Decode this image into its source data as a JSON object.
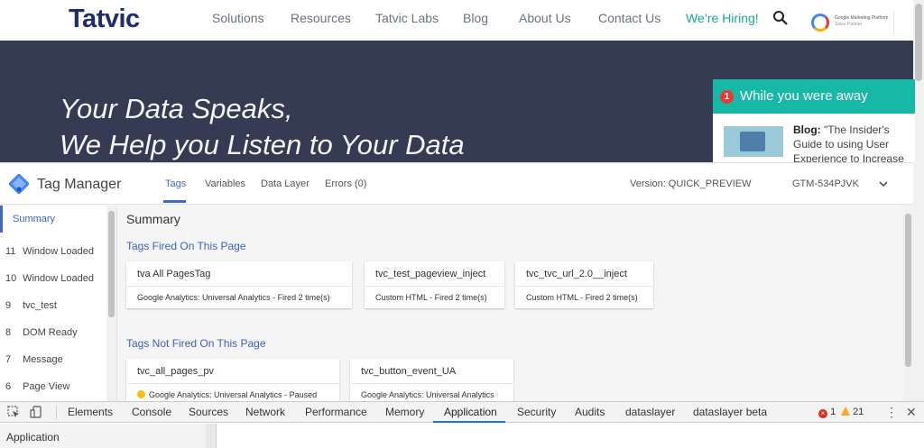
{
  "site": {
    "logo": "Tatvic",
    "nav": [
      {
        "label": "Solutions"
      },
      {
        "label": "Resources"
      },
      {
        "label": "Tatvic Labs"
      },
      {
        "label": "Blog"
      },
      {
        "label": "About Us"
      },
      {
        "label": "Contact Us"
      },
      {
        "label": "We’re Hiring!"
      }
    ],
    "partner": {
      "line1": "Google Marketing Platform",
      "line2": "Sales Partner"
    },
    "hero": {
      "line1": "Your Data Speaks,",
      "line2": "We Help you Listen to Your Data"
    },
    "popup": {
      "count": "1",
      "title": "While you were away",
      "blog_label": "Blog:",
      "blog_text": "\"The Insider's Guide to using User Experience to Increase"
    }
  },
  "tag_manager": {
    "title": "Tag Manager",
    "tabs": [
      {
        "label": "Tags",
        "active": true
      },
      {
        "label": "Variables"
      },
      {
        "label": "Data Layer"
      },
      {
        "label": "Errors (0)"
      }
    ],
    "version": "Version: QUICK_PREVIEW",
    "container_id": "GTM-534PJVK",
    "sidebar": [
      {
        "num": "",
        "label": "Summary",
        "active": true
      },
      {
        "num": "11",
        "label": "Window Loaded"
      },
      {
        "num": "10",
        "label": "Window Loaded"
      },
      {
        "num": "9",
        "label": "tvc_test"
      },
      {
        "num": "8",
        "label": "DOM Ready"
      },
      {
        "num": "7",
        "label": "Message"
      },
      {
        "num": "6",
        "label": "Page View"
      }
    ],
    "summary_title": "Summary",
    "fired_title": "Tags Fired On This Page",
    "fired": [
      {
        "name": "tva All PagesTag",
        "desc": "Google Analytics: Universal Analytics - Fired 2 time(s)"
      },
      {
        "name": "tvc_test_pageview_inject",
        "desc": "Custom HTML - Fired 2 time(s)"
      },
      {
        "name": "tvc_tvc_url_2.0__inject",
        "desc": "Custom HTML - Fired 2 time(s)"
      }
    ],
    "not_fired_title": "Tags Not Fired On This Page",
    "not_fired": [
      {
        "name": "tvc_all_pages_pv",
        "desc": "Google Analytics: Universal Analytics - Paused",
        "paused": true
      },
      {
        "name": "tvc_button_event_UA",
        "desc": "Google Analytics: Universal Analytics"
      }
    ]
  },
  "devtools": {
    "tabs": [
      "Elements",
      "Console",
      "Sources",
      "Network",
      "Performance",
      "Memory",
      "Application",
      "Security",
      "Audits",
      "dataslayer",
      "dataslayer beta"
    ],
    "active_tab": "Application",
    "errors": "1",
    "warnings": "21",
    "more": "⋮",
    "close": "✕",
    "panel_label": "Application"
  },
  "colors": {
    "hero_bg": "#353b52",
    "popup_accent": "#17b8a6",
    "tm_accent": "#4466c9",
    "devtools_active": "#1a73e8"
  }
}
